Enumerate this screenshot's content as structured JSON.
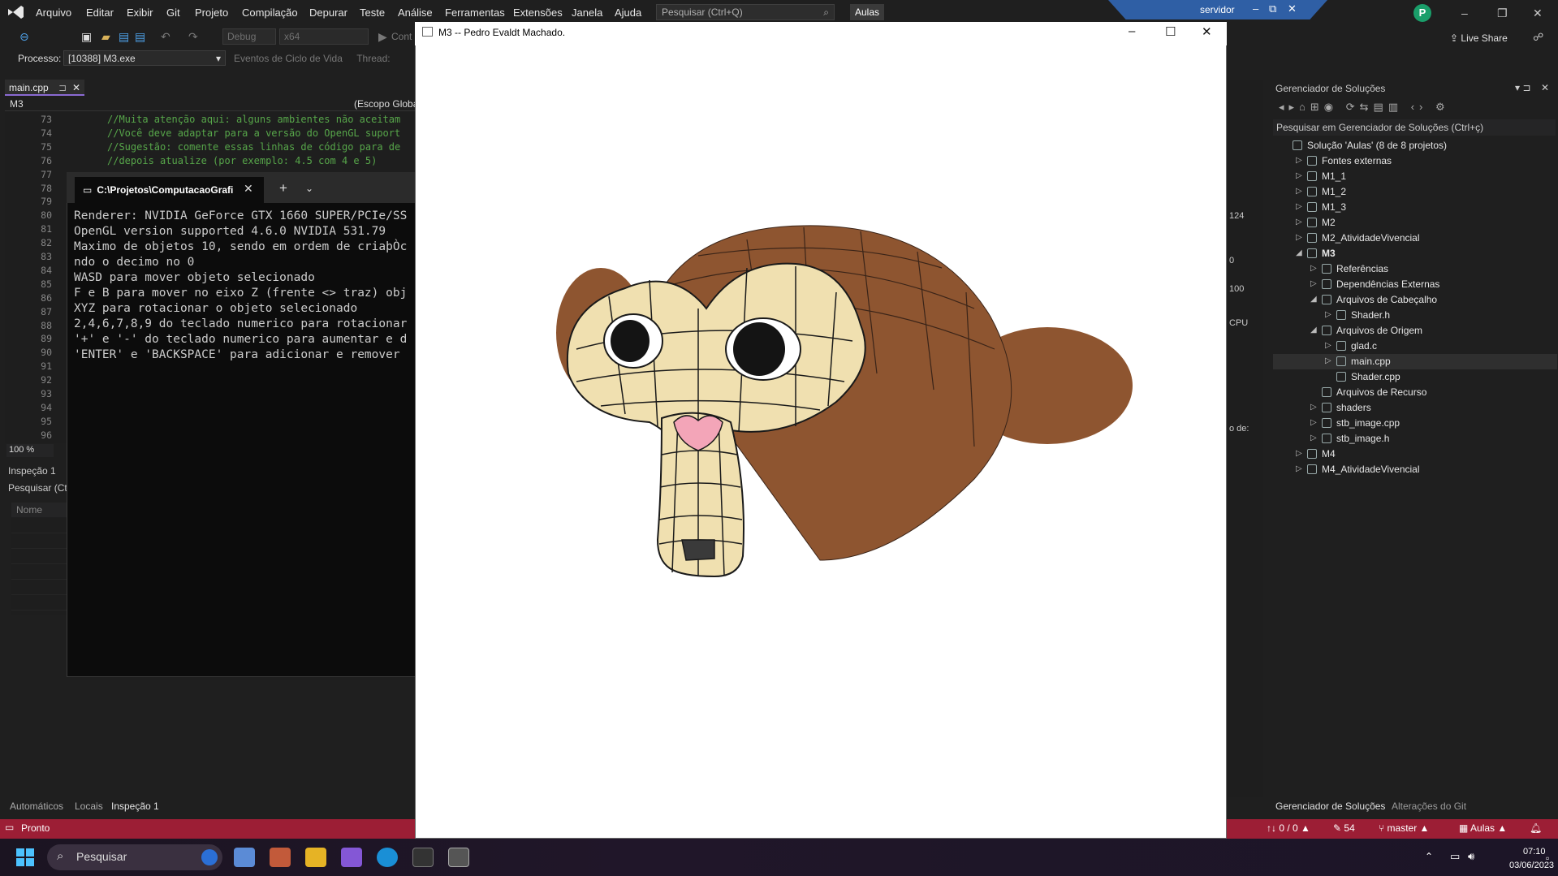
{
  "menubar": {
    "items": [
      "Arquivo",
      "Editar",
      "Exibir",
      "Git",
      "Projeto",
      "Compilação",
      "Depurar",
      "Teste",
      "Análise",
      "Ferramentas",
      "Extensões",
      "Janela",
      "Ajuda"
    ],
    "search_placeholder": "Pesquisar (Ctrl+Q)",
    "solution_name": "Aulas",
    "remote_label": "servidor",
    "avatar_letter": "P"
  },
  "toolbar": {
    "config": "Debug",
    "platform": "x64",
    "continue_label": "Cont",
    "live_share": "Live Share"
  },
  "process_bar": {
    "label": "Processo:",
    "value": "[10388] M3.exe",
    "lifecycle": "Eventos de Ciclo de Vida",
    "thread_label": "Thread:"
  },
  "editor": {
    "tab_name": "main.cpp",
    "nav_left": "M3",
    "nav_right": "(Escopo Globa",
    "zoom": "100 %",
    "lines": [
      {
        "n": "73",
        "code": "//Muita atenção aqui: alguns ambientes não aceitam"
      },
      {
        "n": "74",
        "code": "//Você deve adaptar para a versão do OpenGL suport"
      },
      {
        "n": "75",
        "code": "//Sugestão: comente essas linhas de código para de"
      },
      {
        "n": "76",
        "code": "//depois atualize (por exemplo: 4.5 com 4 e 5)"
      },
      {
        "n": "77",
        "code": ""
      },
      {
        "n": "78",
        "code": ""
      },
      {
        "n": "79",
        "code": ""
      },
      {
        "n": "80",
        "code": ""
      },
      {
        "n": "81",
        "code": ""
      },
      {
        "n": "82",
        "code": ""
      },
      {
        "n": "83",
        "code": ""
      },
      {
        "n": "84",
        "code": ""
      },
      {
        "n": "85",
        "code": ""
      },
      {
        "n": "86",
        "code": ""
      },
      {
        "n": "87",
        "code": ""
      },
      {
        "n": "88",
        "code": ""
      },
      {
        "n": "89",
        "code": ""
      },
      {
        "n": "90",
        "code": ""
      },
      {
        "n": "91",
        "code": ""
      },
      {
        "n": "92",
        "code": ""
      },
      {
        "n": "93",
        "code": ""
      },
      {
        "n": "94",
        "code": ""
      },
      {
        "n": "95",
        "code": ""
      },
      {
        "n": "96",
        "code": ""
      }
    ]
  },
  "watch": {
    "title": "Inspeção 1",
    "search": "Pesquisar (Ct",
    "col_name": "Nome"
  },
  "bottom_tabs": [
    "Automáticos",
    "Locais",
    "Inspeção 1"
  ],
  "terminal": {
    "tab_title": "C:\\Projetos\\ComputacaoGrafi",
    "lines": [
      "Renderer: NVIDIA GeForce GTX 1660 SUPER/PCIe/SS",
      "OpenGL version supported 4.6.0 NVIDIA 531.79",
      "Maximo de objetos 10, sendo em ordem de criaþÒc",
      "ndo o decimo no 0",
      "WASD para mover objeto selecionado",
      "F e B para mover no eixo Z (frente <> traz) obj",
      "XYZ para rotacionar o objeto selecionado",
      "2,4,6,7,8,9 do teclado numerico para rotacionar",
      "'+' e '-' do teclado numerico para aumentar e d",
      "'ENTER' e 'BACKSPACE' para adicionar e remover"
    ]
  },
  "gl_window": {
    "title": "M3 -- Pedro Evaldt Machado."
  },
  "mid_panel": {
    "values": [
      "124",
      "0",
      "100",
      "CPU",
      "o de:"
    ]
  },
  "solution_explorer": {
    "title": "Gerenciador de Soluções",
    "search": "Pesquisar em Gerenciador de Soluções (Ctrl+ç)",
    "rows": [
      {
        "label": "Solução 'Aulas' (8 de 8 projetos)",
        "depth": 0,
        "arrow": ""
      },
      {
        "label": "Fontes externas",
        "depth": 1,
        "arrow": "▷"
      },
      {
        "label": "M1_1",
        "depth": 1,
        "arrow": "▷"
      },
      {
        "label": "M1_2",
        "depth": 1,
        "arrow": "▷"
      },
      {
        "label": "M1_3",
        "depth": 1,
        "arrow": "▷"
      },
      {
        "label": "M2",
        "depth": 1,
        "arrow": "▷"
      },
      {
        "label": "M2_AtividadeVivencial",
        "depth": 1,
        "arrow": "▷"
      },
      {
        "label": "M3",
        "depth": 1,
        "arrow": "◢"
      },
      {
        "label": "Referências",
        "depth": 2,
        "arrow": "▷"
      },
      {
        "label": "Dependências Externas",
        "depth": 2,
        "arrow": "▷"
      },
      {
        "label": "Arquivos de Cabeçalho",
        "depth": 2,
        "arrow": "◢"
      },
      {
        "label": "Shader.h",
        "depth": 3,
        "arrow": "▷"
      },
      {
        "label": "Arquivos de Origem",
        "depth": 2,
        "arrow": "◢"
      },
      {
        "label": "glad.c",
        "depth": 3,
        "arrow": "▷"
      },
      {
        "label": "main.cpp",
        "depth": 3,
        "arrow": "▷"
      },
      {
        "label": "Shader.cpp",
        "depth": 3,
        "arrow": ""
      },
      {
        "label": "Arquivos de Recurso",
        "depth": 2,
        "arrow": ""
      },
      {
        "label": "shaders",
        "depth": 2,
        "arrow": "▷"
      },
      {
        "label": "stb_image.cpp",
        "depth": 2,
        "arrow": "▷"
      },
      {
        "label": "stb_image.h",
        "depth": 2,
        "arrow": "▷"
      },
      {
        "label": "M4",
        "depth": 1,
        "arrow": "▷"
      },
      {
        "label": "M4_AtividadeVivencial",
        "depth": 1,
        "arrow": "▷"
      }
    ],
    "tab_a": "Gerenciador de Soluções",
    "tab_b": "Alterações do Git"
  },
  "statusbar": {
    "text": "Pronto",
    "errors": "↑↓ 0 / 0 ▲",
    "edits": "✎ 54",
    "branch": "master ▲",
    "repo": "Aulas ▲"
  },
  "taskbar": {
    "search": "Pesquisar",
    "time": "07:10",
    "date": "03/06/2023"
  },
  "colors": {
    "accent": "#8a6ad3",
    "status": "#9c1e35",
    "comment": "#57a64a",
    "monkey_skin": "#f0e0b0",
    "monkey_hair": "#8e5530"
  }
}
